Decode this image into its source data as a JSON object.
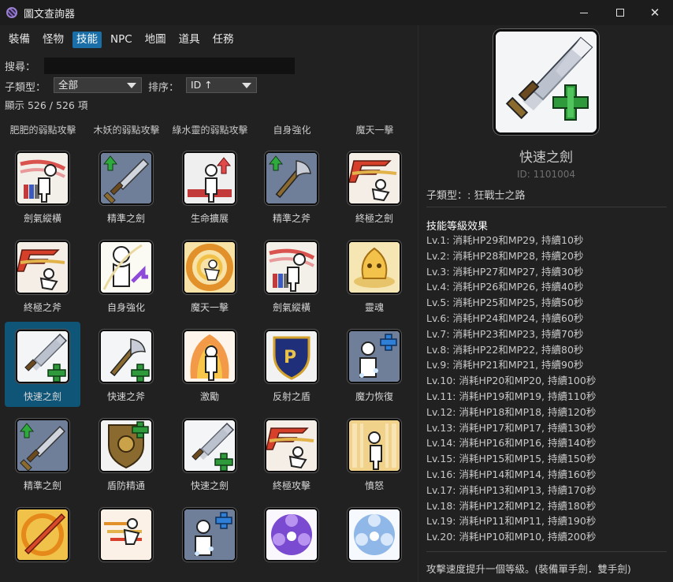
{
  "window": {
    "title": "圖文查詢器"
  },
  "tabs": [
    "裝備",
    "怪物",
    "技能",
    "NPC",
    "地圖",
    "道具",
    "任務"
  ],
  "active_tab": "技能",
  "search": {
    "label": "搜尋：",
    "value": ""
  },
  "filter": {
    "subtype_label": "子類型：",
    "subtype_value": "全部",
    "sort_label": "排序：",
    "sort_value": "ID ↑"
  },
  "count_text": "顯示 526 / 526 項",
  "column_headers": [
    "肥肥的弱點攻擊",
    "木妖的弱點攻擊",
    "綠水靈的弱點攻擊",
    "自身強化",
    "魔天一擊"
  ],
  "grid_rows": [
    [
      {
        "name": "劍氣縱橫",
        "icon": "sword-aura-icon"
      },
      {
        "name": "精準之劍",
        "icon": "sword-mastery-icon"
      },
      {
        "name": "生命擴展",
        "icon": "hp-boost-icon"
      },
      {
        "name": "精準之斧",
        "icon": "axe-mastery-icon"
      },
      {
        "name": "終極之劍",
        "icon": "final-attack-sword-icon"
      }
    ],
    [
      {
        "name": "終極之斧",
        "icon": "final-attack-axe-icon"
      },
      {
        "name": "自身強化",
        "icon": "self-buff-icon"
      },
      {
        "name": "魔天一擊",
        "icon": "rage-strike-icon"
      },
      {
        "name": "劍氣縱橫",
        "icon": "sword-aura-icon"
      },
      {
        "name": "靈魂",
        "icon": "soul-icon"
      }
    ],
    [
      {
        "name": "快速之劍",
        "icon": "sword-booster-icon",
        "selected": true
      },
      {
        "name": "快速之斧",
        "icon": "axe-booster-icon"
      },
      {
        "name": "激勵",
        "icon": "rage-icon"
      },
      {
        "name": "反射之盾",
        "icon": "power-guard-icon"
      },
      {
        "name": "魔力恢復",
        "icon": "mp-recovery-icon"
      }
    ],
    [
      {
        "name": "精準之劍",
        "icon": "sword-mastery-icon"
      },
      {
        "name": "盾防精通",
        "icon": "shield-mastery-icon"
      },
      {
        "name": "快速之劍",
        "icon": "sword-booster-icon"
      },
      {
        "name": "終極攻擊",
        "icon": "final-attack-icon"
      },
      {
        "name": "憤怒",
        "icon": "fury-icon"
      }
    ],
    [
      {
        "name": "",
        "icon": "flame-sword-icon"
      },
      {
        "name": "",
        "icon": "combo-icon"
      },
      {
        "name": "",
        "icon": "mp-recovery-icon"
      },
      {
        "name": "",
        "icon": "purple-orb-icon"
      },
      {
        "name": "",
        "icon": "blue-orb-icon"
      }
    ]
  ],
  "detail": {
    "name": "快速之劍",
    "id_text": "ID: 1101004",
    "subtype_text": "子類型：: 狂戰士之路",
    "levels_title": "技能等級效果",
    "levels": [
      "Lv.1: 消耗HP29和MP29, 持續10秒",
      "Lv.2: 消耗HP28和MP28, 持續20秒",
      "Lv.3: 消耗HP27和MP27, 持續30秒",
      "Lv.4: 消耗HP26和MP26, 持續40秒",
      "Lv.5: 消耗HP25和MP25, 持續50秒",
      "Lv.6: 消耗HP24和MP24, 持續60秒",
      "Lv.7: 消耗HP23和MP23, 持續70秒",
      "Lv.8: 消耗HP22和MP22, 持續80秒",
      "Lv.9: 消耗HP21和MP21, 持續90秒",
      "Lv.10: 消耗HP20和MP20, 持續100秒",
      "Lv.11: 消耗HP19和MP19, 持續110秒",
      "Lv.12: 消耗HP18和MP18, 持續120秒",
      "Lv.13: 消耗HP17和MP17, 持續130秒",
      "Lv.14: 消耗HP16和MP16, 持續140秒",
      "Lv.15: 消耗HP15和MP15, 持續150秒",
      "Lv.16: 消耗HP14和MP14, 持續160秒",
      "Lv.17: 消耗HP13和MP13, 持續170秒",
      "Lv.18: 消耗HP12和MP12, 持續180秒",
      "Lv.19: 消耗HP11和MP11, 持續190秒",
      "Lv.20: 消耗HP10和MP10, 持續200秒"
    ],
    "description": "攻擊速度提升一個等級。(裝備單手劍．雙手劍)"
  },
  "colors": {
    "accent": "#1a6fa8",
    "selected_cell": "#0e5578",
    "background": "#212121"
  }
}
